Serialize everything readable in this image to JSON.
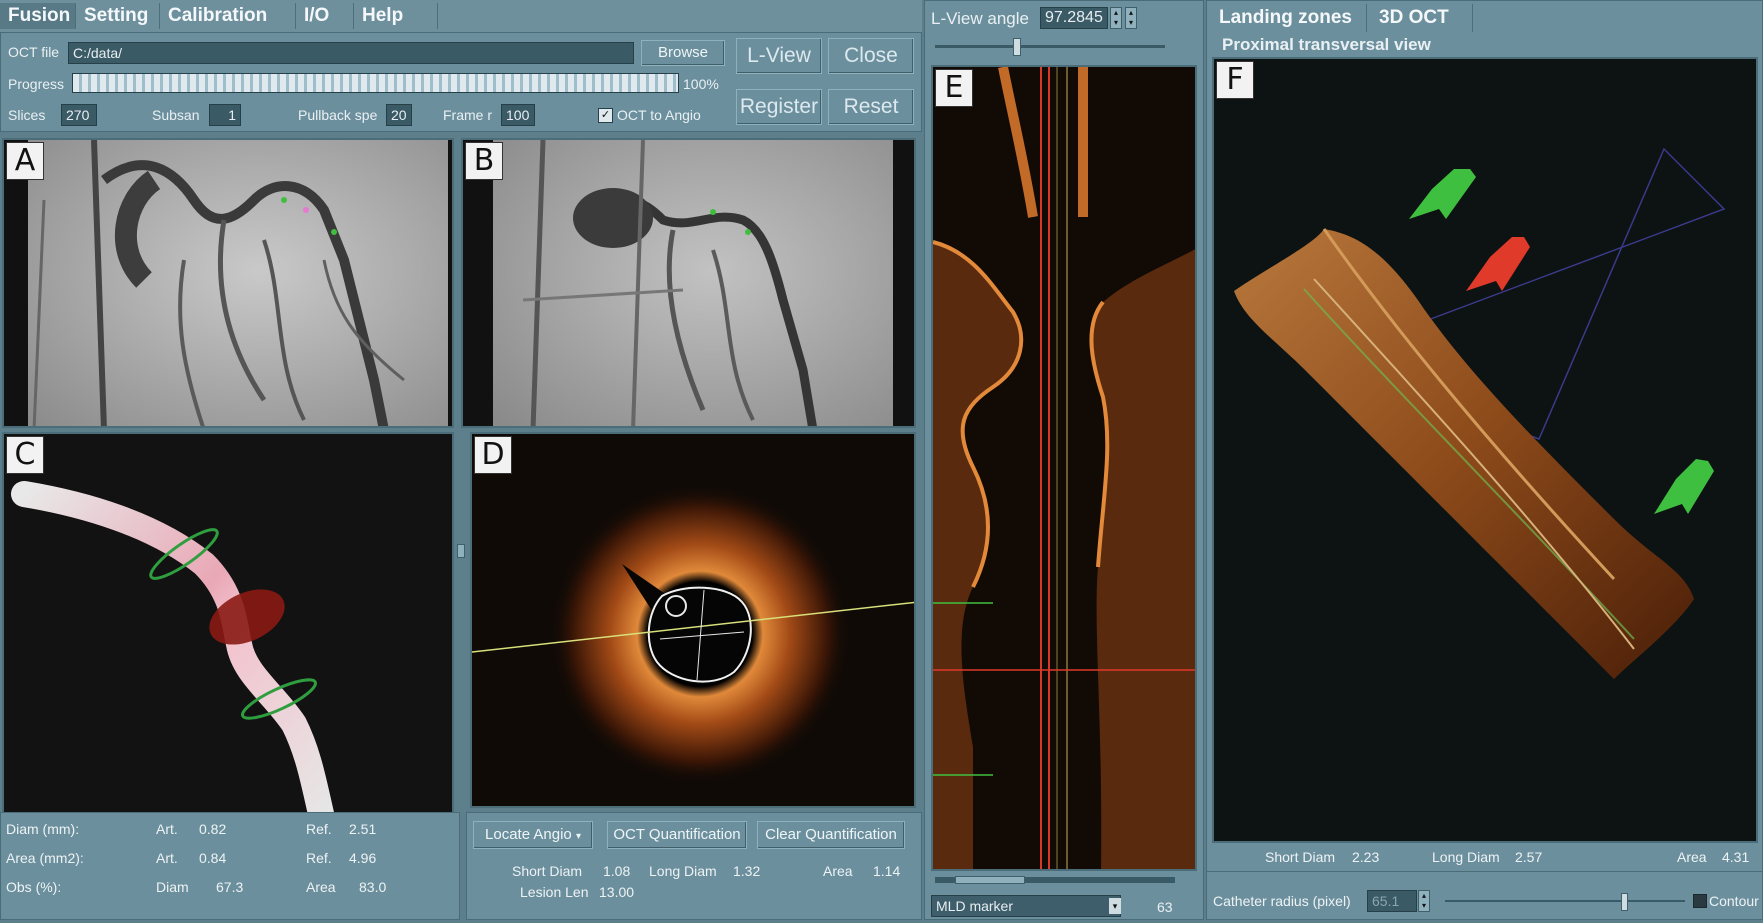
{
  "menu": {
    "items": [
      "Fusion",
      "Setting",
      "Calibration",
      "I/O",
      "Help"
    ]
  },
  "fusion": {
    "oct_file_label": "OCT file",
    "oct_file_value": "C:/data/",
    "browse_label": "Browse",
    "progress_label": "Progress",
    "progress_text": "100%",
    "progress_value": 1.0,
    "slices_label": "Slices",
    "slices_value": "270",
    "subsan_label": "Subsan",
    "subsan_value": "1",
    "pullback_label": "Pullback spe",
    "pullback_value": "20",
    "frame_label": "Frame r",
    "frame_value": "100",
    "oct_to_angio_label": "OCT to Angio",
    "oct_to_angio_checked": true,
    "lview_label": "L-View",
    "close_label": "Close",
    "register_label": "Register",
    "reset_label": "Reset"
  },
  "views": {
    "a": "A",
    "b": "B",
    "c": "C",
    "d": "D",
    "e": "E",
    "f": "F"
  },
  "measure_left": {
    "row1_label": "Diam (mm):",
    "row1_a_label": "Art.",
    "row1_a_value": "0.82",
    "row1_b_label": "Ref.",
    "row1_b_value": "2.51",
    "row2_label": "Area (mm2):",
    "row2_a_label": "Art.",
    "row2_a_value": "0.84",
    "row2_b_label": "Ref.",
    "row2_b_value": "4.96",
    "row3_label": "Obs (%):",
    "row3_a_label": "Diam",
    "row3_a_value": "67.3",
    "row3_b_label": "Area",
    "row3_b_value": "83.0"
  },
  "oct_controls": {
    "locate_angio_label": "Locate Angio",
    "oct_quant_label": "OCT Quantification",
    "clear_quant_label": "Clear Quantification",
    "short_diam_label": "Short Diam",
    "short_diam_value": "1.08",
    "long_diam_label": "Long Diam",
    "long_diam_value": "1.32",
    "area_label": "Area",
    "area_value": "1.14",
    "lesion_len_label": "Lesion Len",
    "lesion_len_value": "13.00"
  },
  "lview": {
    "angle_label": "L-View angle",
    "angle_value": "97.2845",
    "marker_select": "MLD marker",
    "marker_value": "63"
  },
  "right": {
    "tab1": "Landing zones",
    "tab2": "3D OCT",
    "subtitle": "Proximal transversal view",
    "short_diam_label": "Short Diam",
    "short_diam_value": "2.23",
    "long_diam_label": "Long Diam",
    "long_diam_value": "2.57",
    "area_label": "Area",
    "area_value": "4.31",
    "catheter_label": "Catheter radius (pixel)",
    "catheter_value": "65.1",
    "contour_label": "Contour"
  },
  "colors": {
    "panel": "#6c8f9d",
    "oct_orange": "#d27a2a",
    "green_marker": "#3fbf3f",
    "red_marker": "#e03a2a"
  }
}
